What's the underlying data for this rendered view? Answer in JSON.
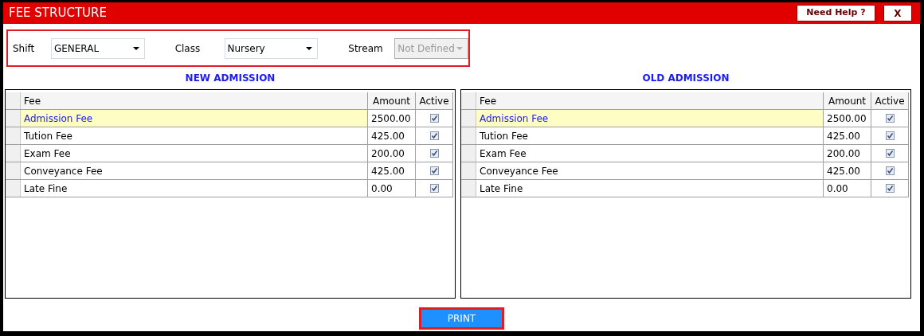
{
  "window": {
    "title": "FEE STRUCTURE"
  },
  "title_buttons": [
    "Need Help ?",
    "X"
  ],
  "filters": [
    {
      "label": "Shift",
      "value": "GENERAL",
      "disabled": false
    },
    {
      "label": "Class",
      "value": "Nursery",
      "disabled": false
    },
    {
      "label": "Stream",
      "value": "Not Defined",
      "disabled": true
    }
  ],
  "panels": [
    {
      "heading": "NEW ADMISSION",
      "columns": [
        "Fee",
        "Amount",
        "Active"
      ],
      "rows": [
        {
          "fee": "Admission Fee",
          "amount": "2500.00",
          "active": true,
          "selected": true
        },
        {
          "fee": "Tution Fee",
          "amount": "425.00",
          "active": true,
          "selected": false
        },
        {
          "fee": "Exam Fee",
          "amount": "200.00",
          "active": true,
          "selected": false
        },
        {
          "fee": "Conveyance Fee",
          "amount": "425.00",
          "active": true,
          "selected": false
        },
        {
          "fee": "Late Fine",
          "amount": "0.00",
          "active": true,
          "selected": false
        }
      ]
    },
    {
      "heading": "OLD ADMISSION",
      "columns": [
        "Fee",
        "Amount",
        "Active"
      ],
      "rows": [
        {
          "fee": "Admission Fee",
          "amount": "2500.00",
          "active": true,
          "selected": true
        },
        {
          "fee": "Tution Fee",
          "amount": "425.00",
          "active": true,
          "selected": false
        },
        {
          "fee": "Exam Fee",
          "amount": "200.00",
          "active": true,
          "selected": false
        },
        {
          "fee": "Conveyance Fee",
          "amount": "425.00",
          "active": true,
          "selected": false
        },
        {
          "fee": "Late Fine",
          "amount": "0.00",
          "active": true,
          "selected": false
        }
      ]
    }
  ],
  "print_button": "PRINT"
}
